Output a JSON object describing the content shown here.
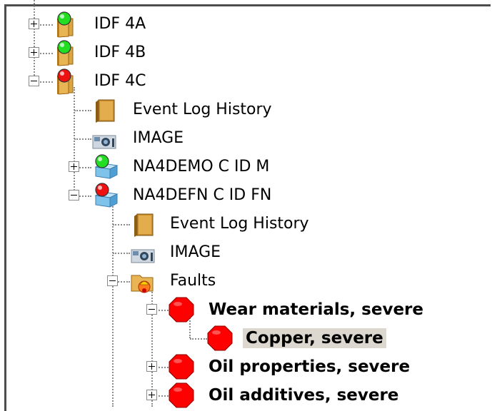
{
  "tree": {
    "nodes": [
      {
        "label": "IDF 4A",
        "icon": "folder-status-green-icon",
        "expander": "plus",
        "bold": false,
        "selected": false
      },
      {
        "label": "IDF 4B",
        "icon": "folder-status-green-icon",
        "expander": "plus",
        "bold": false,
        "selected": false
      },
      {
        "label": "IDF 4C",
        "icon": "folder-status-red-icon",
        "expander": "minus",
        "bold": false,
        "selected": false
      },
      {
        "label": "Event Log History",
        "icon": "event-log-book-icon",
        "expander": "none",
        "bold": false,
        "selected": false
      },
      {
        "label": "IMAGE",
        "icon": "camera-image-icon",
        "expander": "none",
        "bold": false,
        "selected": false
      },
      {
        "label": "NA4DEMO C ID M",
        "icon": "device-status-green-icon",
        "expander": "plus",
        "bold": false,
        "selected": false
      },
      {
        "label": "NA4DEFN C ID FN",
        "icon": "device-status-red-icon",
        "expander": "minus",
        "bold": false,
        "selected": false
      },
      {
        "label": "Event Log History",
        "icon": "event-log-book-icon",
        "expander": "none",
        "bold": false,
        "selected": false
      },
      {
        "label": "IMAGE",
        "icon": "camera-image-icon",
        "expander": "none",
        "bold": false,
        "selected": false
      },
      {
        "label": "Faults",
        "icon": "faults-folder-alarm-icon",
        "expander": "minus",
        "bold": false,
        "selected": false
      },
      {
        "label": "Wear materials, severe",
        "icon": "severe-fault-octagon-icon",
        "expander": "minus",
        "bold": true,
        "selected": false
      },
      {
        "label": "Copper, severe",
        "icon": "severe-fault-octagon-icon",
        "expander": "none",
        "bold": true,
        "selected": true
      },
      {
        "label": "Oil properties, severe",
        "icon": "severe-fault-octagon-icon",
        "expander": "plus",
        "bold": true,
        "selected": false
      },
      {
        "label": "Oil additives, severe",
        "icon": "severe-fault-octagon-icon",
        "expander": "plus",
        "bold": true,
        "selected": false
      }
    ]
  },
  "colors": {
    "status_green": "#22dd22",
    "status_red": "#ee1111",
    "fault_red": "#ff0000",
    "selection_bg": "#ddd8cf",
    "folder_orange": "#d9a441"
  }
}
